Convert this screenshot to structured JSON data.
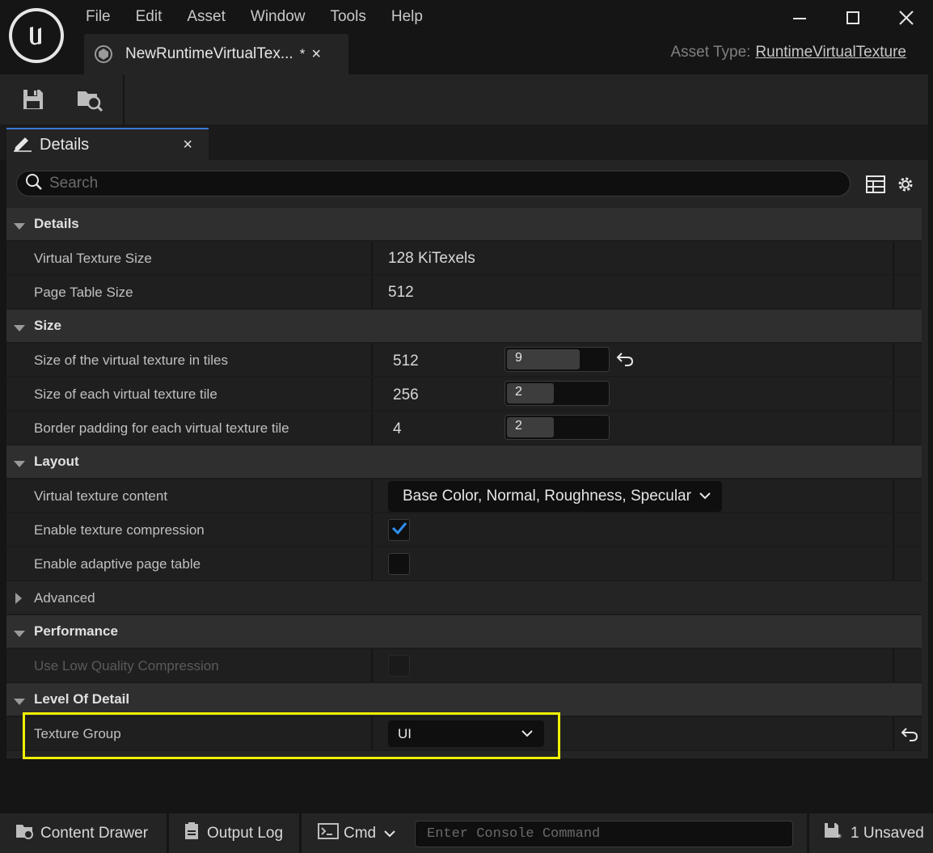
{
  "menu": [
    "File",
    "Edit",
    "Asset",
    "Window",
    "Tools",
    "Help"
  ],
  "window_controls": {
    "minimize": "minimize-icon",
    "maximize": "maximize-icon",
    "close": "close-icon"
  },
  "doc_tab": {
    "label": "NewRuntimeVirtualTex...",
    "dirty": "*",
    "close": "×"
  },
  "asset_type": {
    "label": "Asset Type:",
    "value": "RuntimeVirtualTexture"
  },
  "toolbar": {
    "save_icon": "save-icon",
    "browse_icon": "browse-to-asset-icon"
  },
  "panel_tab": {
    "label": "Details",
    "close": "×"
  },
  "search": {
    "placeholder": "Search"
  },
  "sections": {
    "details": {
      "label": "Details",
      "virtual_texture_size": {
        "name": "Virtual Texture Size",
        "value": "128 KiTexels"
      },
      "page_table_size": {
        "name": "Page Table Size",
        "value": "512"
      }
    },
    "size": {
      "label": "Size",
      "tiles": {
        "name": "Size of the virtual texture in tiles",
        "value": "512",
        "slider": "9"
      },
      "tile_size": {
        "name": "Size of each virtual texture tile",
        "value": "256",
        "slider": "2"
      },
      "border": {
        "name": "Border padding for each virtual texture tile",
        "value": "4",
        "slider": "2"
      }
    },
    "layout": {
      "label": "Layout",
      "content": {
        "name": "Virtual texture content",
        "value": "Base Color, Normal, Roughness, Specular"
      },
      "compression": {
        "name": "Enable texture compression",
        "checked": true
      },
      "adaptive": {
        "name": "Enable adaptive page table",
        "checked": false
      }
    },
    "advanced": {
      "label": "Advanced"
    },
    "performance": {
      "label": "Performance",
      "low_quality": {
        "name": "Use Low Quality Compression",
        "checked": false
      }
    },
    "lod": {
      "label": "Level Of Detail",
      "texture_group": {
        "name": "Texture Group",
        "value": "UI"
      }
    }
  },
  "statusbar": {
    "content_drawer": "Content Drawer",
    "output_log": "Output Log",
    "cmd": "Cmd",
    "console_placeholder": "Enter Console Command",
    "unsaved": "1 Unsaved"
  }
}
